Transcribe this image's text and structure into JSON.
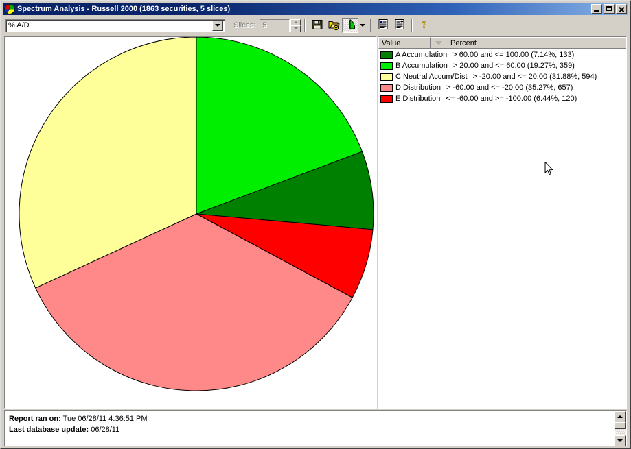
{
  "window": {
    "title": "Spectrum Analysis - Russell 2000 (1863 securities, 5 slices)",
    "app_icon": "pie-chart-icon",
    "minimize_label": "",
    "maximize_label": "",
    "close_label": ""
  },
  "toolbar": {
    "field_select_value": "% A/D",
    "field_select_placeholder": "% A/D",
    "slices_label": "Slices:",
    "slices_value": "5",
    "buttons": [
      {
        "name": "save-button",
        "icon": "floppy-disk-icon",
        "label": ""
      },
      {
        "name": "open-add-button",
        "icon": "folder-add-icon",
        "label": ""
      },
      {
        "name": "pie-chart-view-button",
        "icon": "pie-chart-icon",
        "label": ""
      },
      {
        "name": "chart-type-dropdown-button",
        "icon": "chevron-down-icon",
        "label": ""
      },
      {
        "name": "report-list-button",
        "icon": "list-report-icon",
        "label": ""
      },
      {
        "name": "report-add-button",
        "icon": "list-add-icon",
        "label": ""
      },
      {
        "name": "help-button",
        "icon": "question-mark-icon",
        "label": ""
      }
    ]
  },
  "legend": {
    "columns": [
      "Value",
      "Percent"
    ],
    "sort_indicator": "descending",
    "rows": [
      {
        "color": "#008000",
        "name": "A Accumulation",
        "desc": "> 60.00 and <= 100.00 (7.14%, 133)"
      },
      {
        "color": "#00EE00",
        "name": "B Accumulation",
        "desc": "> 20.00 and <= 60.00 (19.27%, 359)"
      },
      {
        "color": "#FFFF99",
        "name": "C Neutral Accum/Dist",
        "desc": "> -20.00 and <= 20.00 (31.88%, 594)"
      },
      {
        "color": "#FF8888",
        "name": "D Distribution",
        "desc": "> -60.00 and <= -20.00 (35.27%, 657)"
      },
      {
        "color": "#FF0000",
        "name": "E Distribution",
        "desc": "<= -60.00 and >= -100.00 (6.44%, 120)"
      }
    ]
  },
  "status": {
    "report_label": "Report ran on:",
    "report_value": "Tue 06/28/11 4:36:51 PM",
    "database_label": "Last database update:",
    "database_value": "06/28/11"
  },
  "chart_data": {
    "type": "pie",
    "title": "Spectrum Analysis - Russell 2000",
    "categories": [
      "B Accumulation",
      "A Accumulation",
      "E Distribution",
      "D Distribution",
      "C Neutral Accum/Dist"
    ],
    "values": [
      19.27,
      7.14,
      6.44,
      35.27,
      31.88
    ],
    "counts": [
      359,
      133,
      120,
      657,
      594
    ],
    "colors": [
      "#00EE00",
      "#008000",
      "#FF0000",
      "#FF8888",
      "#FFFF99"
    ],
    "ranges": [
      "> 20.00 and <= 60.00",
      "> 60.00 and <= 100.00",
      "<= -60.00 and >= -100.00",
      "> -60.00 and <= -20.00",
      "> -20.00 and <= 20.00"
    ],
    "total_securities": 1863,
    "slices": 5,
    "start_angle_deg": 0,
    "direction": "clockwise",
    "legend_position": "right",
    "center": [
      279,
      258
    ],
    "radius": 258,
    "xlabel": "",
    "ylabel": ""
  }
}
